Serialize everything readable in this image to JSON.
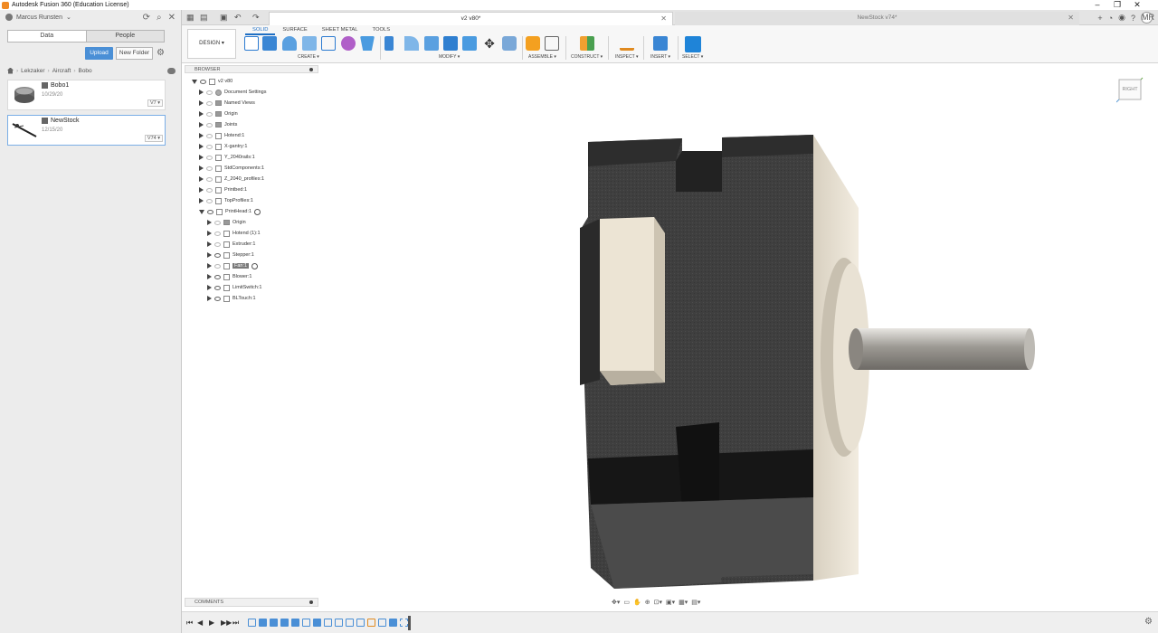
{
  "window": {
    "title": "Autodesk Fusion 360 (Education License)",
    "controls": [
      "–",
      "❐",
      "✕"
    ]
  },
  "data_panel": {
    "user": "Marcus Runsten",
    "tabs": {
      "data": "Data",
      "people": "People"
    },
    "upload": "Upload",
    "new_folder": "New Folder",
    "breadcrumb": [
      "Lekzaker",
      "Aircraft",
      "Bobo"
    ],
    "files": [
      {
        "name": "Bobo1",
        "date": "10/29/20",
        "version": "V7"
      },
      {
        "name": "NewStock",
        "date": "12/15/20",
        "version": "V74"
      }
    ]
  },
  "tabs": [
    {
      "label": "v2 v80*"
    },
    {
      "label": "NewStock v74*"
    }
  ],
  "user_initials": "MR",
  "toolbar": {
    "design": "DESIGN ▾",
    "workspace_tabs": [
      "SOLID",
      "SURFACE",
      "SHEET METAL",
      "TOOLS"
    ],
    "groups": [
      "CREATE ▾",
      "MODIFY ▾",
      "ASSEMBLE ▾",
      "CONSTRUCT ▾",
      "INSPECT ▾",
      "INSERT ▾",
      "SELECT ▾"
    ]
  },
  "browser": {
    "header": "BROWSER",
    "root": "v2 v80",
    "items": [
      "Document Settings",
      "Named Views",
      "Origin",
      "Joints",
      "Hotend:1",
      "X-gantry:1",
      "Y_2040rails:1",
      "StdComponents:1",
      "Z_2040_profiles:1",
      "Printbed:1",
      "TopProfiles:1",
      "PrintHead:1"
    ],
    "children": [
      "Origin",
      "Hotend (1):1",
      "Extruder:1",
      "Stepper:1",
      "Fan:1",
      "Blower:1",
      "LimitSwitch:1",
      "BLTouch:1"
    ]
  },
  "comments": "COMMENTS",
  "viewcube_label": "RIGHT",
  "colors": {
    "accent": "#1f6fc4",
    "upload": "#4a8fd6",
    "motor_body": "#3d3d3d",
    "flange": "#ede6d8"
  }
}
